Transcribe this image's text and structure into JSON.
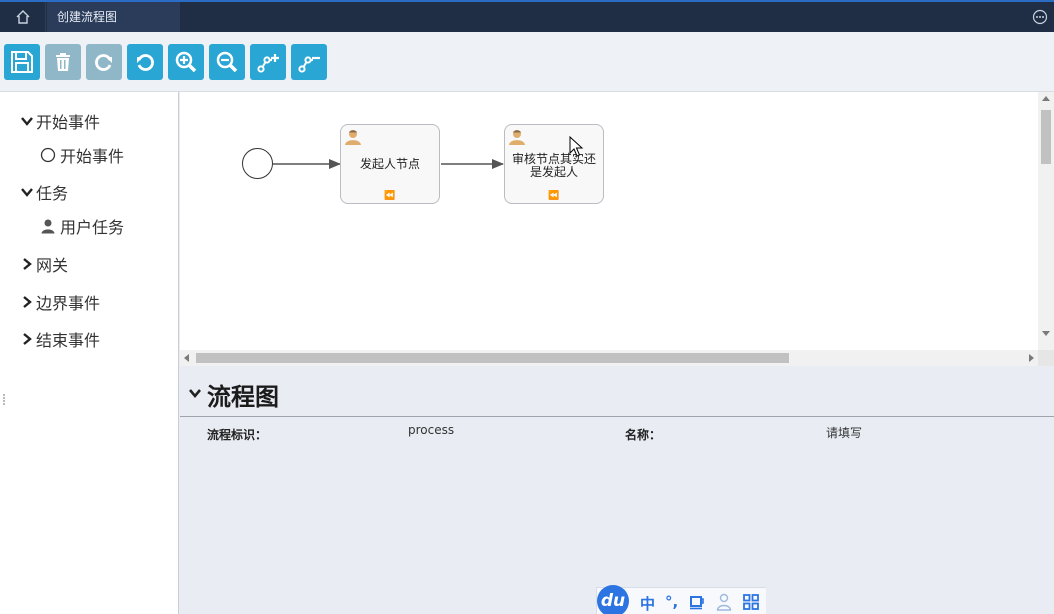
{
  "topbar": {
    "tab_title": "创建流程图",
    "accent": "#2b6cc4",
    "bg": "#1f2d45"
  },
  "toolbar": {
    "buttons": [
      {
        "icon": "save-icon",
        "enabled": true
      },
      {
        "icon": "trash-icon",
        "enabled": false
      },
      {
        "icon": "redo-icon",
        "enabled": false
      },
      {
        "icon": "undo-icon",
        "enabled": true
      },
      {
        "icon": "zoom-in-icon",
        "enabled": true
      },
      {
        "icon": "zoom-out-icon",
        "enabled": true
      },
      {
        "icon": "add-bendpoint-icon",
        "enabled": true
      },
      {
        "icon": "remove-bendpoint-icon",
        "enabled": true
      }
    ],
    "accent": "#2aa6d4"
  },
  "palette": {
    "groups": [
      {
        "label": "开始事件",
        "expanded": true,
        "items": [
          {
            "label": "开始事件",
            "icon": "circle-icon"
          }
        ]
      },
      {
        "label": "任务",
        "expanded": true,
        "items": [
          {
            "label": "用户任务",
            "icon": "user-icon"
          }
        ]
      },
      {
        "label": "网关",
        "expanded": false
      },
      {
        "label": "边界事件",
        "expanded": false
      },
      {
        "label": "结束事件",
        "expanded": false
      }
    ]
  },
  "diagram": {
    "tasks": [
      {
        "label": "发起人节点"
      },
      {
        "label_line1": "审核节点其实还",
        "label_line2": "是发起人"
      }
    ],
    "marker": "⏪"
  },
  "properties": {
    "title": "流程图",
    "fields": [
      {
        "label": "流程标识：",
        "value": "process"
      },
      {
        "label": "名称：",
        "value": "请填写"
      }
    ]
  },
  "ime": {
    "logo": "du",
    "items": [
      "中",
      "°,"
    ]
  }
}
